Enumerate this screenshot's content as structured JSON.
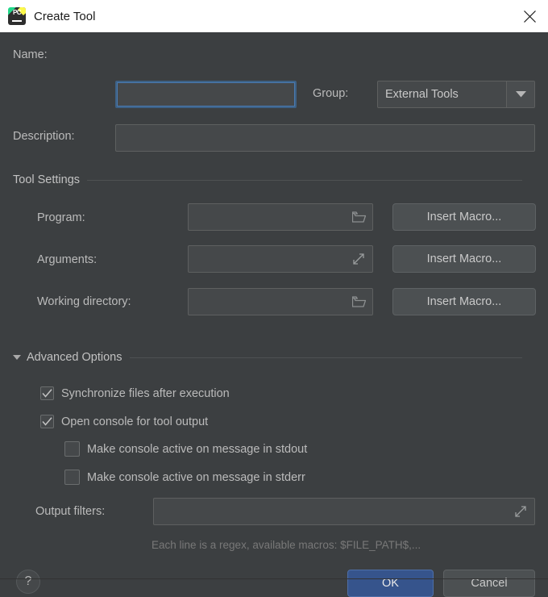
{
  "window": {
    "title": "Create Tool",
    "app_icon": "pycharm-icon",
    "close_icon": "close-icon"
  },
  "form": {
    "name": {
      "label": "Name:",
      "value": "",
      "placeholder": "",
      "focused": true
    },
    "description": {
      "label": "Description:",
      "value": "",
      "placeholder": ""
    },
    "group": {
      "label": "Group:",
      "value": "External Tools",
      "options": [
        "External Tools"
      ]
    }
  },
  "tool_settings": {
    "section_title": "Tool Settings",
    "rows": [
      {
        "label": "Program:",
        "value": "",
        "trail_icon": "folder-icon",
        "button": "Insert Macro..."
      },
      {
        "label": "Arguments:",
        "value": "",
        "trail_icon": "expand-icon",
        "button": "Insert Macro..."
      },
      {
        "label": "Working directory:",
        "value": "",
        "trail_icon": "folder-icon",
        "button": "Insert Macro..."
      }
    ]
  },
  "advanced_options": {
    "section_title": "Advanced Options",
    "expanded": true,
    "toggle_icon": "triangle-down-icon",
    "checkboxes": [
      {
        "label": "Synchronize files after execution",
        "checked": true,
        "indent": 0
      },
      {
        "label": "Open console for tool output",
        "checked": true,
        "indent": 0
      },
      {
        "label": "Make console active on message in stdout",
        "checked": false,
        "indent": 1
      },
      {
        "label": "Make console active on message in stderr",
        "checked": false,
        "indent": 1
      }
    ],
    "output_filters": {
      "label": "Output filters:",
      "value": "",
      "trail_icon": "expand-icon",
      "hint": "Each line is a regex, available macros: $FILE_PATH$,..."
    }
  },
  "footer": {
    "help_label": "?",
    "ok_label": "OK",
    "cancel_label": "Cancel"
  },
  "colors": {
    "dialog_bg": "#3c3f41",
    "field_bg": "#45484a",
    "accent_blue": "#36548c",
    "focus_border": "#4a7ab0",
    "text": "#bbbbbb",
    "hint_text": "#787878"
  }
}
